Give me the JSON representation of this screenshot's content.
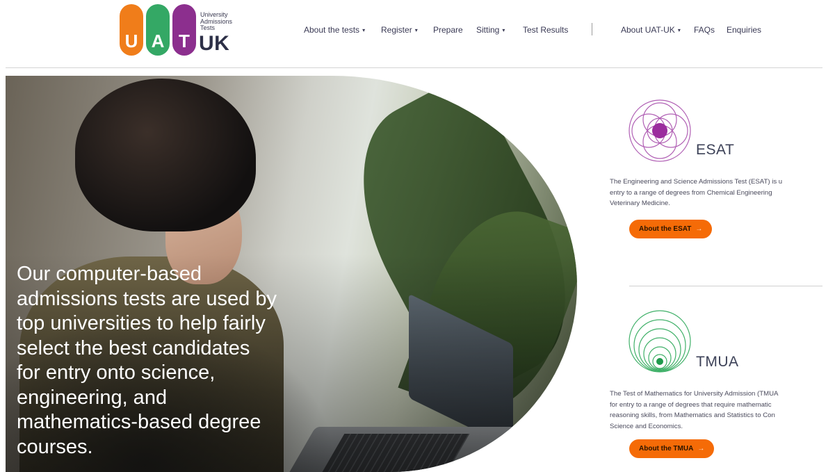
{
  "logo": {
    "letters": [
      "U",
      "A",
      "T"
    ],
    "small_text": [
      "University",
      "Admissions",
      "Tests"
    ],
    "suffix": "UK",
    "colors": {
      "u": "#f07d1a",
      "a": "#34a865",
      "t": "#8c2f8e"
    }
  },
  "nav": {
    "items": [
      {
        "label": "About the tests",
        "dropdown": true
      },
      {
        "label": "Register",
        "dropdown": true
      },
      {
        "label": "Prepare",
        "dropdown": false
      },
      {
        "label": "Sitting",
        "dropdown": true
      },
      {
        "label": "Test Results",
        "dropdown": false
      }
    ],
    "secondary": [
      {
        "label": "About UAT-UK",
        "dropdown": true
      },
      {
        "label": "FAQs",
        "dropdown": false
      },
      {
        "label": "Enquiries",
        "dropdown": false
      }
    ],
    "caret": "▾"
  },
  "hero": {
    "lines": [
      "Our computer-based",
      "admissions tests are used by",
      "top universities to help fairly",
      "select the best candidates",
      "for entry onto science,",
      "engineering, and",
      "mathematics-based degree",
      "courses."
    ]
  },
  "tests": {
    "esat": {
      "title": "ESAT",
      "icon": "esat-circles-icon",
      "description": [
        "The Engineering and Science Admissions Test (ESAT) is u",
        "entry to a range of degrees from Chemical Engineering",
        "Veterinary Medicine."
      ],
      "button": "About the ESAT",
      "accent": "#a23aa6"
    },
    "tmua": {
      "title": "TMUA",
      "icon": "tmua-rings-icon",
      "description": [
        "The Test of Mathematics for University Admission (TMUA",
        "for entry to a range of degrees that require mathematic",
        "reasoning skills, from Mathematics and Statistics to Con",
        "Science and Economics."
      ],
      "button": "About the TMUA",
      "accent": "#2fa85a"
    },
    "button_arrow": "→",
    "button_color": "#f56b07"
  }
}
